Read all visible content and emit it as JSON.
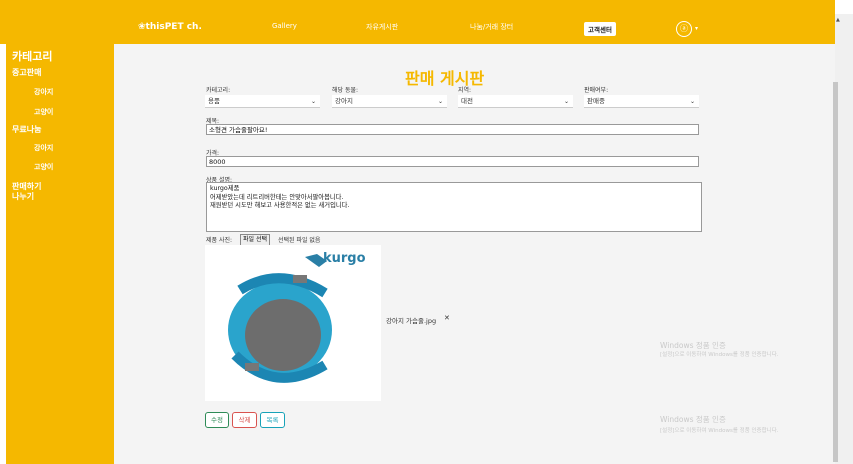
{
  "nav": {
    "brand": "thisPET ch.",
    "gallery": "Gallery",
    "board": "자유게시판",
    "share": "나눔/거래 장터",
    "customer": "고객센터"
  },
  "sidebar": {
    "category": "카테고리",
    "used": "중고판매",
    "used_dog": "강아지",
    "used_cat": "고양이",
    "free": "무료나눔",
    "free_dog": "강아지",
    "free_cat": "고양이",
    "sell": "판매하기",
    "share": "나누기"
  },
  "form": {
    "title": "판매 게시판",
    "category_label": "카테고리:",
    "category_value": "용품",
    "animal_label": "해당 동물:",
    "animal_value": "강아지",
    "region_label": "지역:",
    "region_value": "대전",
    "status_label": "판매여부:",
    "status_value": "판매중",
    "subject_label": "제목:",
    "subject_value": "소형견 가슴줄팔아요!",
    "price_label": "가격:",
    "price_value": "8000",
    "desc_label": "상품 설명:",
    "desc_line1": "kurgo제품",
    "desc_line2": "어제받았는데 리트리버한테는 안맞아서팔아봅니다.",
    "desc_line3": "재원받던 시도만 해보고 사용한적은 없는 새거입니다.",
    "photo_label": "제품 사진:",
    "file_button": "파일 선택",
    "file_status": "선택된 파일 없음",
    "brand_logo": "kurgo",
    "file_name": "강아지 가슴줄.jpg",
    "remove": "✕"
  },
  "buttons": {
    "edit": "수정",
    "delete": "삭제",
    "list": "목록"
  },
  "watermark": {
    "title": "Windows 정품 인증",
    "sub": "[설정]으로 이동하여 Windows를 정품 인증합니다."
  },
  "colors": {
    "accent": "#f5b800",
    "edit": "#2e8b57",
    "delete": "#d9534f",
    "list": "#17a2b8"
  },
  "icons": {
    "brand": "paw-icon",
    "avatar": "user-avatar-icon",
    "dropdown": "chevron-down-icon"
  }
}
